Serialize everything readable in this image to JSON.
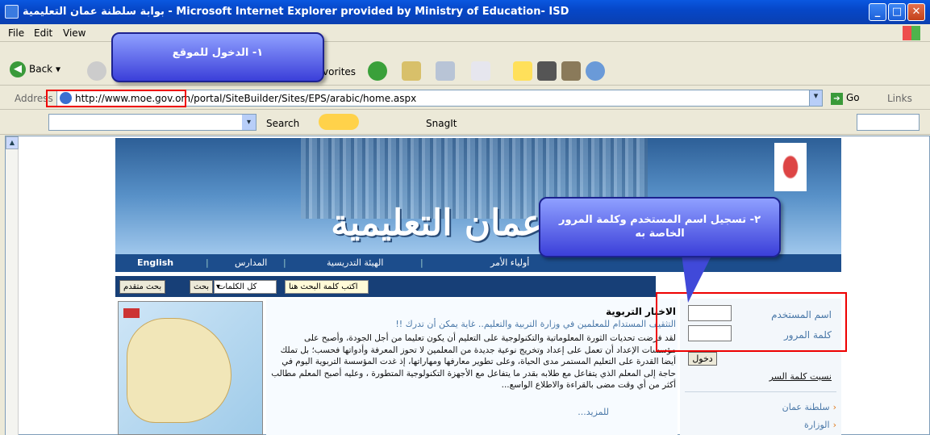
{
  "window": {
    "title": "بوابة سلطنة عمان التعليمية - Microsoft Internet Explorer provided by Ministry of Education- ISD",
    "minimize": "_",
    "maximize": "□",
    "close": "✕"
  },
  "menu": {
    "file": "File",
    "edit": "Edit",
    "view": "View"
  },
  "toolbar": {
    "back": "Back",
    "favorites": "vorites"
  },
  "callout1": {
    "text": "١- الدخول للموقع"
  },
  "address": {
    "label": "Address",
    "url": "http://www.moe.gov.om/portal/SiteBuilder/Sites/EPS/arabic/home.aspx",
    "go": "Go",
    "links": "Links"
  },
  "searchbar": {
    "search": "Search",
    "snagit": "SnagIt"
  },
  "site": {
    "banner_title": "سلطنة عمان التعليمية",
    "nav": {
      "english": "English",
      "schools": "المدارس",
      "staff": "الهيئة التدريسية",
      "parents": "أولياء الأمر"
    },
    "search": {
      "placeholder": "اكتب كلمة البحث هنا",
      "all_words": "كل الكلمات",
      "search_btn": "بحث",
      "advanced_btn": "بحث متقدم"
    },
    "news": {
      "heading": "الاخبار التربوية",
      "subtitle": "التثقيف المستدام للمعلمين في وزارة التربية والتعليم.. غاية يمكن أن تدرك !!",
      "body": "لقد فرضت تحديات الثورة المعلوماتية والتكنولوجية على التعليم أن يكون تعليما من أجل الجودة، وأصبح على مؤسسات الإعداد أن تعمل على إعداد وتخريج نوعية جديدة من المعلمين لا تحوز المعرفة وأدواتها فحسب؛ بل تملك أيضا القدرة على التعليم المستمر مدى الحياة، وعلى تطوير معارفها ومهاراتها، إذ غدت المؤسسة التربوية اليوم في حاجة إلى المعلم الذي يتفاعل مع طلابه بقدر ما يتفاعل مع الأجهزة التكنولوجية المتطورة ، وعليه أصبح المعلم مطالب أكثر من أي وقت مضى بالقراءة والاطلاع الواسع...",
      "more": "للمزيد..."
    },
    "login": {
      "username_label": "اسم المستخدم",
      "password_label": "كلمة المرور",
      "login_btn": "دخول",
      "forgot": "نسيت كلمة السر"
    },
    "side_links": [
      "سلطنة عمان",
      "الوزارة"
    ]
  },
  "callout2": {
    "text": "٢- تسجيل اسم المستخدم وكلمة المرور الخاصة به"
  }
}
